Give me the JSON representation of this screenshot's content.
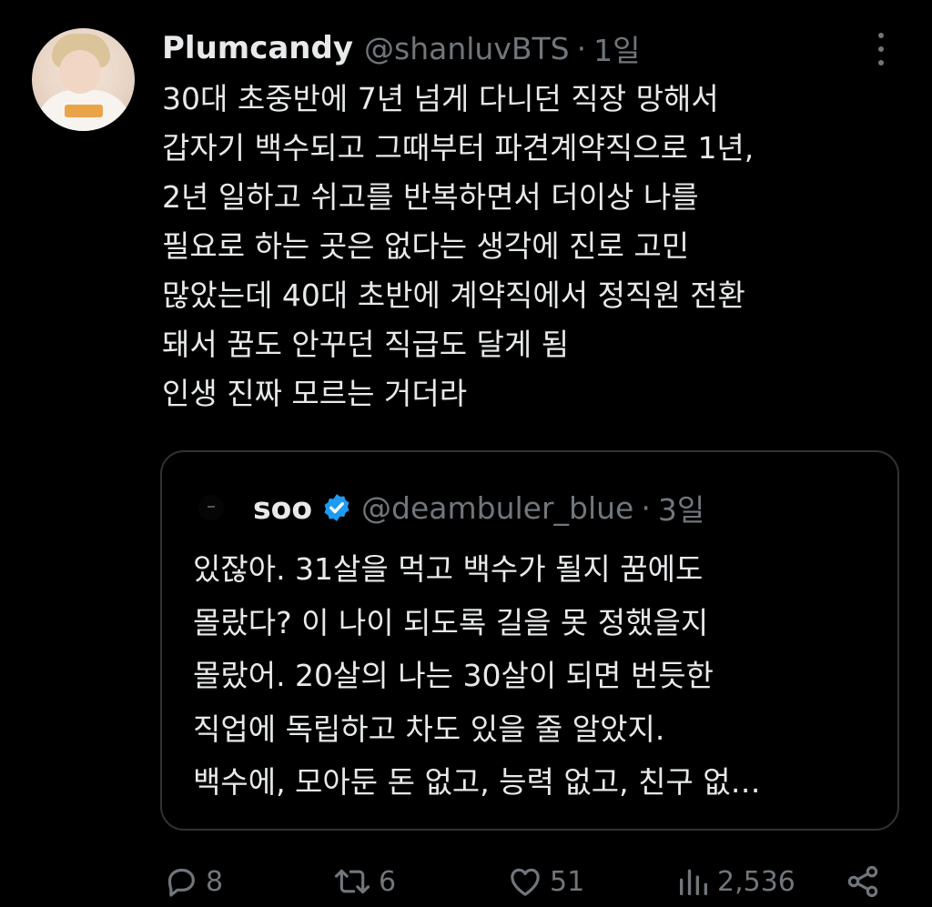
{
  "tweet": {
    "author_name": "Plumcandy",
    "handle": "@shanluvBTS",
    "separator": "·",
    "time": "1일",
    "text": "30대 초중반에 7년 넘게 다니던 직장 망해서\n갑자기 백수되고 그때부터 파견계약직으로 1년,\n2년 일하고 쉬고를 반복하면서 더이상 나를\n필요로 하는 곳은 없다는 생각에 진로 고민\n많았는데 40대 초반에 계약직에서 정직원 전환\n돼서 꿈도 안꾸던 직급도 달게 됨\n인생 진짜 모르는 거더라"
  },
  "quoted_tweet": {
    "author_name": "soo",
    "verified": true,
    "handle": "@deambuler_blue",
    "separator": "·",
    "time": "3일",
    "text": "있잖아. 31살을 먹고 백수가 될지 꿈에도\n몰랐다? 이 나이 되도록 길을 못 정했을지\n몰랐어. 20살의 나는 30살이 되면 번듯한\n직업에 독립하고 차도 있을 줄 알았지.\n백수에, 모아둔 돈 없고, 능력 없고, 친구 없…"
  },
  "actions": {
    "replies": "8",
    "retweets": "6",
    "likes": "51",
    "views": "2,536"
  },
  "icons": {
    "more": "more-dots-icon",
    "reply": "reply-icon",
    "retweet": "retweet-icon",
    "like": "heart-icon",
    "views": "views-icon",
    "share": "share-icon",
    "verified": "verified-badge-icon"
  },
  "colors": {
    "background": "#000000",
    "text": "#e7e9ea",
    "muted": "#71767b",
    "border": "#2f3336",
    "verified": "#1d9bf0"
  }
}
